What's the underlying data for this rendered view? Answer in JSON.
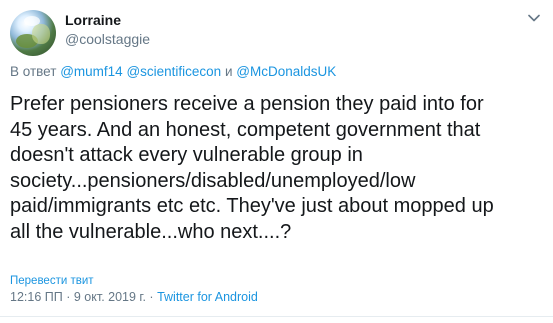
{
  "author": {
    "display_name": "Lorraine",
    "handle": "@coolstaggie"
  },
  "reply": {
    "prefix": "В ответ",
    "mentions": [
      "@mumf14",
      "@scientificecon",
      "@McDonaldsUK"
    ],
    "conjunction": "и"
  },
  "tweet": {
    "lines": [
      "Prefer pensioners receive a pension they paid into for",
      "45 years. And an honest, competent government that",
      "doesn't attack every vulnerable group in",
      "society...pensioners/disabled/unemployed/low",
      "paid/immigrants etc etc. They've just about mopped up",
      "all the vulnerable...who next....?"
    ]
  },
  "actions": {
    "translate_label": "Перевести твит"
  },
  "meta": {
    "time": "12:16 ПП",
    "separator": "·",
    "date": "9 окт. 2019 г.",
    "source": "Twitter for Android"
  },
  "icons": {
    "menu": "chevron-down-icon",
    "avatar": "avatar"
  },
  "colors": {
    "link": "#1b95e0",
    "secondary_text": "#657786",
    "primary_text": "#14171a"
  }
}
